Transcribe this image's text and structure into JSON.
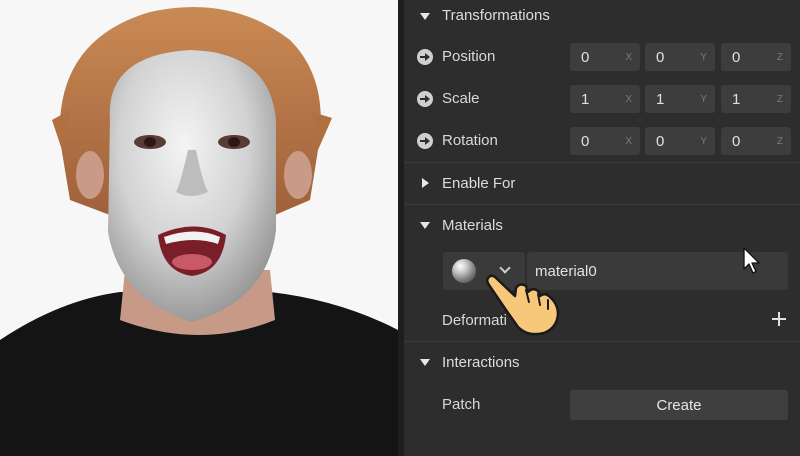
{
  "inspector": {
    "transformations": {
      "title": "Transformations",
      "position": {
        "label": "Position",
        "x": "0",
        "y": "0",
        "z": "0"
      },
      "scale": {
        "label": "Scale",
        "x": "1",
        "y": "1",
        "z": "1"
      },
      "rotation": {
        "label": "Rotation",
        "x": "0",
        "y": "0",
        "z": "0"
      },
      "axis_labels": {
        "x": "X",
        "y": "Y",
        "z": "Z"
      }
    },
    "enable_for": {
      "title": "Enable For"
    },
    "materials": {
      "title": "Materials",
      "selected": "material0"
    },
    "deformations": {
      "label": "Deformati"
    },
    "interactions": {
      "title": "Interactions",
      "patch_label": "Patch",
      "create_label": "Create"
    }
  },
  "colors": {
    "panel_bg": "#2d2d2d",
    "field_bg": "#3d3d3d",
    "viewport_bg": "#f7f7f7"
  },
  "icons": [
    "collapse-triangle-icon",
    "expand-triangle-icon",
    "arrow-circle-icon",
    "material-sphere-icon",
    "chevron-down-icon",
    "plus-icon",
    "mouse-cursor-icon",
    "pointing-hand-icon"
  ]
}
